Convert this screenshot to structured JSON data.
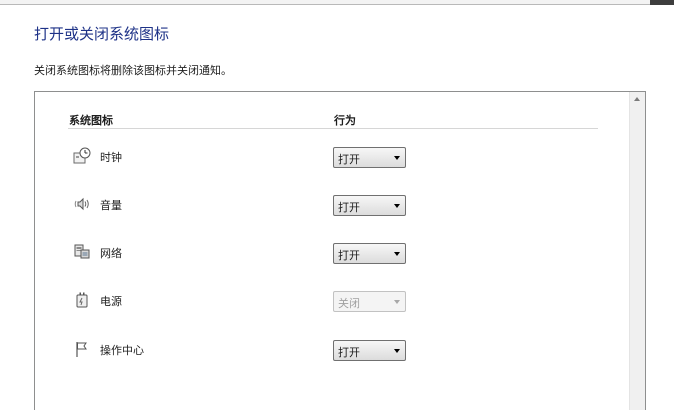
{
  "page": {
    "title": "打开或关闭系统图标",
    "description": "关闭系统图标将删除该图标并关闭通知。"
  },
  "table": {
    "columns": {
      "icon": "系统图标",
      "behavior": "行为"
    },
    "rows": [
      {
        "icon": "clock-icon",
        "label": "时钟",
        "behavior": "打开",
        "enabled": true
      },
      {
        "icon": "volume-icon",
        "label": "音量",
        "behavior": "打开",
        "enabled": true
      },
      {
        "icon": "network-icon",
        "label": "网络",
        "behavior": "打开",
        "enabled": true
      },
      {
        "icon": "power-icon",
        "label": "电源",
        "behavior": "关闭",
        "enabled": false
      },
      {
        "icon": "action-center-flag-icon",
        "label": "操作中心",
        "behavior": "打开",
        "enabled": true
      }
    ]
  }
}
